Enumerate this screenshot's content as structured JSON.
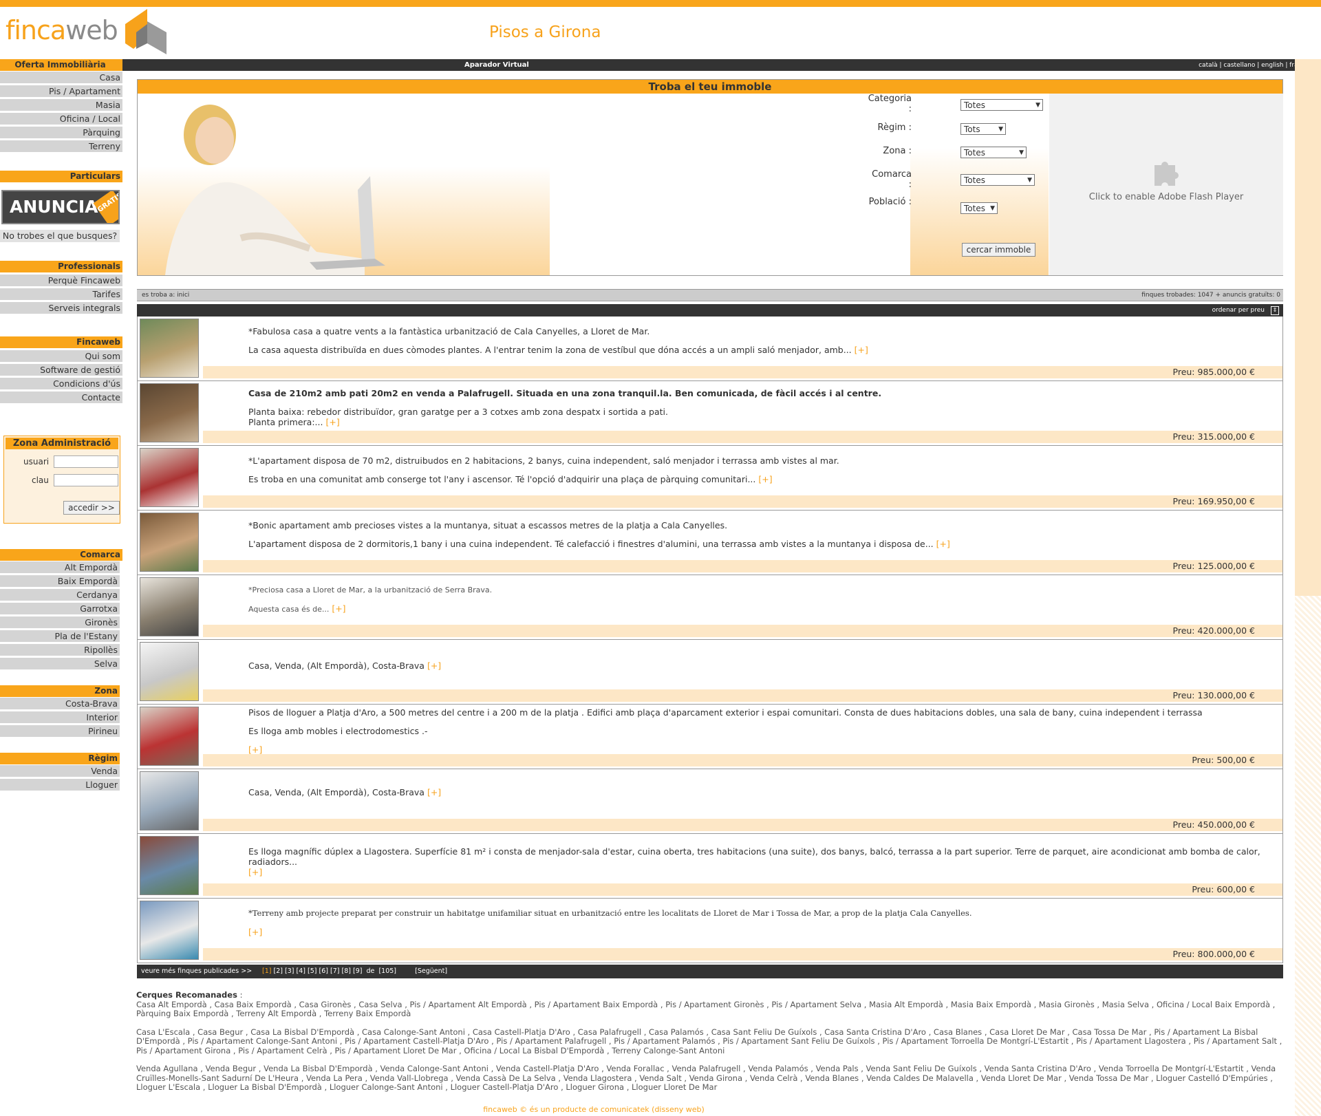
{
  "header": {
    "logo_part1": "finca",
    "logo_part2": "web",
    "page_title": "Pisos a Girona"
  },
  "topbar": {
    "center_label": "Aparador Virtual",
    "languages": [
      "català",
      "castellano",
      "english",
      "français"
    ],
    "separator": " | "
  },
  "sidebar": {
    "oferta": {
      "title": "Oferta Immobiliària",
      "items": [
        "Casa",
        "Pis / Apartament",
        "Masia",
        "Oficina / Local",
        "Pàrquing",
        "Terreny"
      ]
    },
    "particulars": {
      "title": "Particulars",
      "banner_text": "ANUNCIA'T",
      "banner_badge": "GRATIS",
      "notrobes": "No trobes el que busques?"
    },
    "professionals": {
      "title": "Professionals",
      "items": [
        "Perquè Fincaweb",
        "Tarifes",
        "Serveis integrals"
      ]
    },
    "fincaweb": {
      "title": "Fincaweb",
      "items": [
        "Qui som",
        "Software de gestió",
        "Condicions d'ús",
        "Contacte"
      ]
    },
    "admin": {
      "title": "Zona Administració",
      "user_label": "usuari",
      "pass_label": "clau",
      "button": "accedir >>"
    },
    "comarca": {
      "title": "Comarca",
      "items": [
        "Alt Empordà",
        "Baix Empordà",
        "Cerdanya",
        "Garrotxa",
        "Gironès",
        "Pla de l'Estany",
        "Ripollès",
        "Selva"
      ]
    },
    "zona": {
      "title": "Zona",
      "items": [
        "Costa-Brava",
        "Interior",
        "Pirineu"
      ]
    },
    "regim": {
      "title": "Règim",
      "items": [
        "Venda",
        "Lloguer"
      ]
    }
  },
  "search": {
    "title": "Troba el teu immoble",
    "categoria_label": "Categoria :",
    "categoria_value": "Totes",
    "regim_label": "Règim :",
    "regim_value": "Tots",
    "zona_label": "Zona :",
    "zona_value": "Totes",
    "comarca_label": "Comarca :",
    "comarca_value": "Totes",
    "poblacio_label": "Població :",
    "poblacio_value": "Totes",
    "button": "cercar immoble",
    "flash_text": "Click to enable Adobe Flash Player"
  },
  "results": {
    "breadcrumb": "es troba a: inici",
    "found_text": "finques trobades: 1047 + anuncis gratuïts: 0",
    "sort_label": "ordenar per preu",
    "more_label": "[+]",
    "listings": [
      {
        "line1": "*Fabulosa casa a quatre vents a la fantàstica urbanització de Cala Canyelles, a Lloret de Mar.",
        "line2": "La casa aquesta distribuïda en dues còmodes plantes. A l'entrar tenim la zona de vestíbul que dóna accés a un ampli saló menjador, amb...",
        "price": "Preu: 985.000,00 €"
      },
      {
        "line1": "Casa de 210m2 amb pati 20m2 en venda a Palafrugell. Situada en una zona tranquil.la. Ben comunicada, de fàcil accés i al centre.",
        "line2": "Planta baixa: rebedor distribuïdor, gran garatge per a 3 cotxes amb zona despatx i sortida a pati.",
        "line3": "Planta primera:...",
        "price": "Preu: 315.000,00 €"
      },
      {
        "line1": "*L'apartament disposa de 70 m2, distruibudos en 2 habitacions, 2 banys, cuina independent, saló menjador i terrassa amb vistes al mar.",
        "line2": "Es troba en una comunitat amb conserge tot l'any i ascensor. Té l'opció d'adquirir una plaça de pàrquing comunitari...",
        "price": "Preu: 169.950,00 €"
      },
      {
        "line1": "*Bonic apartament amb precioses vistes a la muntanya, situat a escassos metres de la platja a Cala Canyelles.",
        "line2": "L'apartament disposa de 2 dormitoris,1 bany i una cuina independent. Té calefacció i finestres d'alumini, una terrassa amb vistes a la muntanya i disposa de...",
        "price": "Preu: 125.000,00 €"
      },
      {
        "line1": "*Preciosa casa a Lloret de Mar, a la urbanització de Serra Brava.",
        "line2": "Aquesta casa és de...",
        "price": "Preu: 420.000,00 €"
      },
      {
        "line1": "Casa, Venda, (Alt Empordà), Costa-Brava",
        "price": "Preu: 130.000,00 €"
      },
      {
        "line1": "Pisos de lloguer a Platja d'Aro, a 500 metres del centre i a 200 m de la platja . Edifici amb plaça d'aparcament exterior i espai comunitari. Consta de dues habitacions dobles, una sala de bany, cuina independent i terrassa",
        "line2": "Es lloga amb mobles i electrodomestics .-",
        "price": "Preu: 500,00 €"
      },
      {
        "line1": "Casa, Venda, (Alt Empordà), Costa-Brava",
        "price": "Preu: 450.000,00 €"
      },
      {
        "line1": "Es lloga magnífic dúplex a Llagostera. Superfície 81 m² i consta de menjador-sala d'estar, cuina oberta, tres habitacions (una suite), dos banys, balcó, terrassa a la part superior.  Terre de parquet, aire acondicionat amb bomba de calor, radiadors...",
        "price": "Preu: 600,00 €"
      },
      {
        "line1": "*Terreny amb projecte preparat per construir un habitatge unifamiliar situat en urbanització entre les localitats de Lloret de Mar i Tossa de Mar, a prop de la platja Cala Canyelles.",
        "price": "Preu: 800.000,00 €"
      }
    ]
  },
  "pager": {
    "label": "veure més finques publicades >>",
    "current": "[1]",
    "pages": [
      "[2]",
      "[3]",
      "[4]",
      "[5]",
      "[6]",
      "[7]",
      "[8]",
      "[9]"
    ],
    "of_label": "de",
    "total": "[105]",
    "next": "[Següent]"
  },
  "cerques": {
    "title": "Cerques Recomanades",
    "p1": "Casa Alt Empordà , Casa Baix Empordà , Casa Gironès , Casa Selva , Pis / Apartament Alt Empordà , Pis / Apartament Baix Empordà , Pis / Apartament Gironès , Pis / Apartament Selva , Masia Alt Empordà , Masia Baix Empordà , Masia Gironès , Masia Selva , Oficina / Local Baix Empordà , Pàrquing Baix Empordà , Terreny Alt Empordà , Terreny Baix Empordà",
    "p2": "Casa L'Escala , Casa Begur , Casa La Bisbal D'Empordà , Casa Calonge-Sant Antoni , Casa Castell-Platja D'Aro , Casa Palafrugell , Casa Palamós , Casa Sant Feliu De Guíxols , Casa Santa Cristina D'Aro , Casa Blanes , Casa Lloret De Mar , Casa Tossa De Mar , Pis / Apartament La Bisbal D'Empordà , Pis / Apartament Calonge-Sant Antoni , Pis / Apartament Castell-Platja D'Aro , Pis / Apartament Palafrugell , Pis / Apartament Palamós , Pis / Apartament Sant Feliu De Guíxols , Pis / Apartament Torroella De Montgrí-L'Estartit , Pis / Apartament Llagostera , Pis / Apartament Salt , Pis / Apartament Girona , Pis / Apartament Celrà , Pis / Apartament Lloret De Mar , Oficina / Local La Bisbal D'Empordà , Terreny Calonge-Sant Antoni",
    "p3": "Venda Agullana , Venda Begur , Venda La Bisbal D'Empordà , Venda Calonge-Sant Antoni , Venda Castell-Platja D'Aro , Venda Forallac , Venda Palafrugell , Venda Palamós , Venda Pals , Venda Sant Feliu De Guíxols , Venda Santa Cristina D'Aro , Venda Torroella De Montgrí-L'Estartit , Venda Cruïlles-Monells-Sant Sadurní De L'Heura , Venda La Pera , Venda Vall-Llobrega , Venda Cassà De La Selva , Venda Llagostera , Venda Salt , Venda Girona , Venda Celrà , Venda Blanes , Venda Caldes De Malavella , Venda Lloret De Mar , Venda Tossa De Mar , Lloguer Castelló D'Empúries , Lloguer L'Escala , Lloguer La Bisbal D'Empordà , Lloguer Calonge-Sant Antoni , Lloguer Castell-Platja D'Aro , Lloguer Girona , Lloguer Lloret De Mar"
  },
  "footer": "fincaweb © és un producte de comunicatek (disseny web)"
}
